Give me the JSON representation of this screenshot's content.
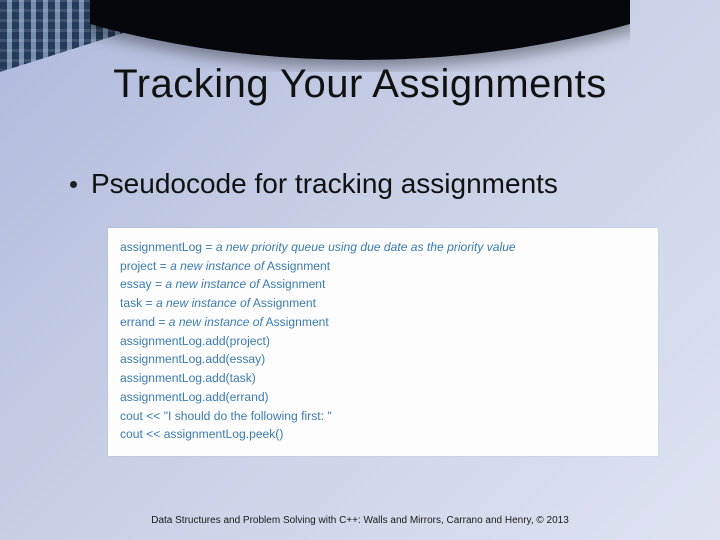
{
  "slide": {
    "title": "Tracking Your Assignments",
    "bullet": "Pseudocode for tracking assignments",
    "footer": "Data Structures and Problem Solving with C++: Walls and Mirrors, Carrano and Henry, ©  2013"
  },
  "code": {
    "l1a": "assignmentLog = ",
    "l1b": "a new priority queue using due date as the priority value",
    "l2a": "project = ",
    "l2b": "a new instance of",
    "l2c": " Assignment",
    "l3a": "essay = ",
    "l3b": "a new instance of",
    "l3c": " Assignment",
    "l4a": "task = ",
    "l4b": "a new instance of",
    "l4c": " Assignment",
    "l5a": "errand = ",
    "l5b": "a new instance of",
    "l5c": " Assignment",
    "l6": "assignmentLog.add(project)",
    "l7": "assignmentLog.add(essay)",
    "l8": "assignmentLog.add(task)",
    "l9": "assignmentLog.add(errand)",
    "l10": "cout << \"I should do the following first: \"",
    "l11": "cout << assignmentLog.peek()"
  }
}
